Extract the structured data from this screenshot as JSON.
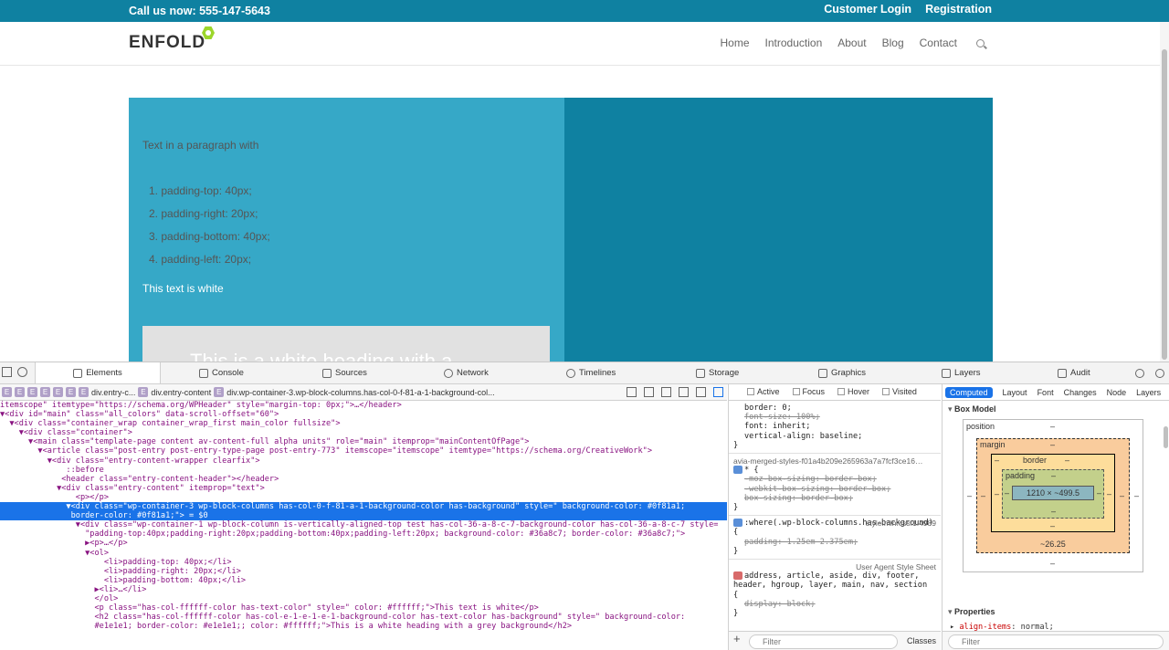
{
  "site": {
    "phone": "Call us now: 555-147-5643",
    "customer_login": "Customer Login",
    "registration": "Registration",
    "logo": "ENFOLD",
    "nav": [
      "Home",
      "Introduction",
      "About",
      "Blog",
      "Contact"
    ]
  },
  "page": {
    "paragraph": "Text in a paragraph with",
    "list": [
      "1.  padding-top: 40px;",
      "2.  padding-right: 20px;",
      "3.  padding-bottom: 40px;",
      "4.  padding-left: 20px;"
    ],
    "white_text": "This text is white",
    "heading": "This is a white heading with a",
    "colors": {
      "dark_bg": "#0f81a1",
      "light_bg": "#36a8c7",
      "grey_bg": "#e1e1e1"
    }
  },
  "devtools": {
    "tabs": [
      "Elements",
      "Console",
      "Sources",
      "Network",
      "Timelines",
      "Storage",
      "Graphics",
      "Layers",
      "Audit"
    ],
    "breadcrumb": [
      "div.entry-c...",
      "div.entry-content",
      "div.wp-container-3.wp-block-columns.has-col-0-f-81-a-1-background-col..."
    ],
    "dom": [
      "itemscope\" itemtype=\"https://schema.org/WPHeader\" style=\"margin-top: 0px;\">…</header>",
      "▼<div id=\"main\" class=\"all_colors\" data-scroll-offset=\"60\">",
      "  ▼<div class=\"container_wrap container_wrap_first main_color fullsize\">",
      "    ▼<div class=\"container\">",
      "      ▼<main class=\"template-page content av-content-full alpha units\" role=\"main\" itemprop=\"mainContentOfPage\">",
      "        ▼<article class=\"post-entry post-entry-type-page post-entry-773\" itemscope=\"itemscope\" itemtype=\"https://schema.org/CreativeWork\">",
      "          ▼<div class=\"entry-content-wrapper clearfix\">",
      "              ::before",
      "             <header class=\"entry-content-header\"></header>",
      "            ▼<div class=\"entry-content\" itemprop=\"text\">",
      "                <p></p>",
      "              ▼<div class=\"wp-container-3 wp-block-columns has-col-0-f-81-a-1-background-color has-background\" style=\" background-color: #0f81a1;",
      "               border-color: #0f81a1;\"> = $0",
      "                ▼<div class=\"wp-container-1 wp-block-column is-vertically-aligned-top test has-col-36-a-8-c-7-background-color has-col-36-a-8-c-7 style=",
      "                  \"padding-top:40px;padding-right:20px;padding-bottom:40px;padding-left:20px; background-color: #36a8c7; border-color: #36a8c7;\">",
      "                  ▶<p>…</p>",
      "                  ▼<ol>",
      "                      <li>padding-top: 40px;</li>",
      "                      <li>padding-right: 20px;</li>",
      "                      <li>padding-bottom: 40px;</li>",
      "                    ▶<li>…</li>",
      "                    </ol>",
      "                    <p class=\"has-col-ffffff-color has-text-color\" style=\" color: #ffffff;\">This text is white</p>",
      "                    <h2 class=\"has-col-ffffff-color has-col-e-1-e-1-e-1-background-color has-text-color has-background\" style=\" background-color:",
      "                    #e1e1e1; border-color: #e1e1e1;; color: #ffffff;\">This is a white heading with a grey background</h2>"
    ],
    "states": [
      "Active",
      "Focus",
      "Hover",
      "Visited"
    ],
    "styles": {
      "rule1": [
        "border: 0;",
        "font-size: 100%;",
        "font: inherit;",
        "vertical-align: baseline;",
        "}"
      ],
      "rule2_src": "avia-merged-styles-f01a4b209e265963a7a7fcf3ce16…",
      "rule2": [
        "* {",
        "-moz-box-sizing: border-box;",
        "-webkit-box-sizing: border-box;",
        "box-sizing: border-box;",
        "}"
      ],
      "rule3_selector": ":where(.wp-block-columns.has-background) {",
      "rule3_src": "style.min.css:1:4989",
      "rule3": [
        "padding: 1.25em 2.375em;",
        "}"
      ],
      "rule4_src": "User Agent Style Sheet",
      "rule4_selector": "address, article, aside, div, footer, header, hgroup, layer, main, nav, section {",
      "rule4": [
        "display: block;",
        "}"
      ],
      "filter_placeholder": "Filter",
      "classes": "Classes"
    },
    "computed": {
      "tabs": [
        "Computed",
        "Layout",
        "Font",
        "Changes",
        "Node",
        "Layers"
      ],
      "box_model_title": "Box Model",
      "position": "position",
      "margin": "margin",
      "border": "border",
      "padding": "padding",
      "content": "1210 × ~499.5",
      "dash": "–",
      "bottom_value": "~26.25",
      "properties_title": "Properties",
      "prop_key": "align-items",
      "prop_val": "normal;",
      "filter_placeholder": "Filter"
    }
  }
}
